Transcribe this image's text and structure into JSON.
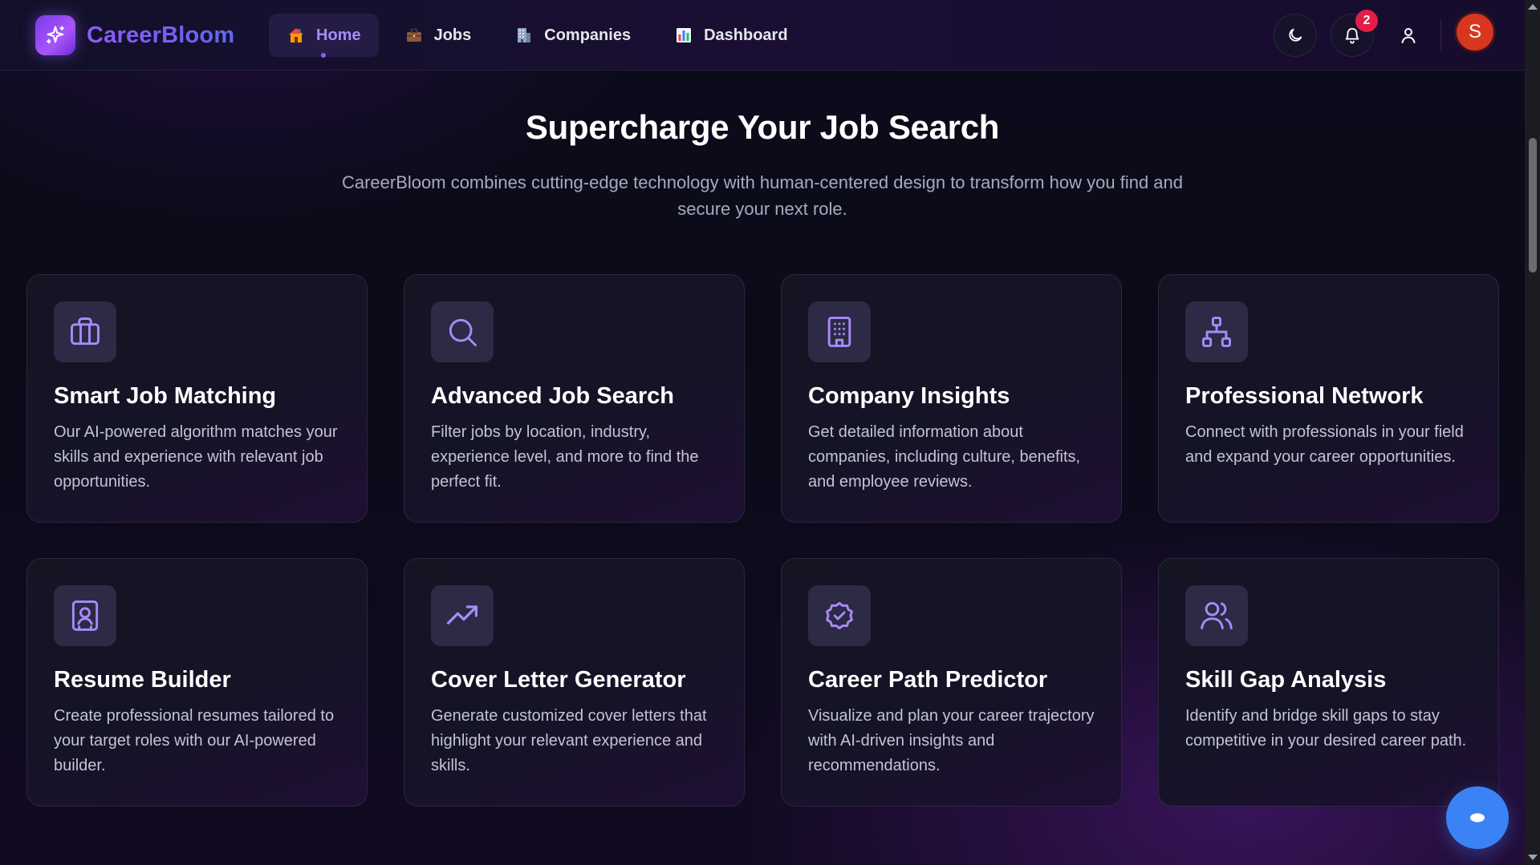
{
  "header": {
    "brand": "CareerBloom",
    "nav": [
      {
        "label": "Home",
        "icon": "house-icon",
        "active": true
      },
      {
        "label": "Jobs",
        "icon": "briefcase-icon",
        "active": false
      },
      {
        "label": "Companies",
        "icon": "office-building-icon",
        "active": false
      },
      {
        "label": "Dashboard",
        "icon": "bar-chart-icon",
        "active": false
      }
    ],
    "notification_count": "2",
    "avatar_initial": "S"
  },
  "hero": {
    "title": "Supercharge Your Job Search",
    "subtitle": "CareerBloom combines cutting-edge technology with human-centered design to transform how you find and secure your next role."
  },
  "features": [
    {
      "icon": "briefcase-icon",
      "title": "Smart Job Matching",
      "description": "Our AI-powered algorithm matches your skills and experience with relevant job opportunities."
    },
    {
      "icon": "search-icon",
      "title": "Advanced Job Search",
      "description": "Filter jobs by location, industry, experience level, and more to find the perfect fit."
    },
    {
      "icon": "building-icon",
      "title": "Company Insights",
      "description": "Get detailed information about companies, including culture, benefits, and employee reviews."
    },
    {
      "icon": "network-icon",
      "title": "Professional Network",
      "description": "Connect with professionals in your field and expand your career opportunities."
    },
    {
      "icon": "contact-book-icon",
      "title": "Resume Builder",
      "description": "Create professional resumes tailored to your target roles with our AI-powered builder."
    },
    {
      "icon": "trending-up-icon",
      "title": "Cover Letter Generator",
      "description": "Generate customized cover letters that highlight your relevant experience and skills."
    },
    {
      "icon": "badge-check-icon",
      "title": "Career Path Predictor",
      "description": "Visualize and plan your career trajectory with AI-driven insights and recommendations."
    },
    {
      "icon": "users-icon",
      "title": "Skill Gap Analysis",
      "description": "Identify and bridge skill gaps to stay competitive in your desired career path."
    }
  ],
  "colors": {
    "accent": "#8b5cf6",
    "icon_stroke": "#a78bfa",
    "notification_badge": "#e11d48",
    "avatar": "#d9361f",
    "fab": "#3b82f6"
  }
}
